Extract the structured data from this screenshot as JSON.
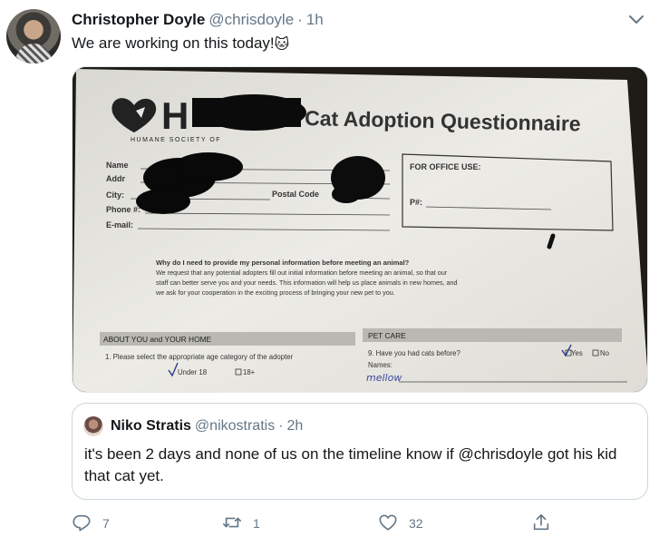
{
  "tweet": {
    "author": {
      "display_name": "Christopher Doyle",
      "handle": "@chrisdoyle",
      "time": "1h"
    },
    "separator": "·",
    "text": "We are working on this today!",
    "emoji": "🐱",
    "media": {
      "org_letters": "H",
      "org_name": "HUMANE SOCIETY OF",
      "title": "Cat Adoption Questionnaire",
      "fields": {
        "name": "Name",
        "address": "Addr",
        "city": "City:",
        "postal": "Postal Code",
        "phone": "Phone #:",
        "email": "E-mail:"
      },
      "office_use": "FOR OFFICE USE:",
      "p_number": "P#:",
      "why_heading": "Why do I need to provide my personal information before meeting an animal?",
      "why_lines": [
        "We request that any potential adopters fill out initial information before meeting an animal, so that our",
        "staff can better serve you and your needs. This information will help us place animals in new homes, and",
        "we ask for your cooperation in the exciting process of bringing your new pet to you."
      ],
      "section_left": "ABOUT YOU and YOUR HOME",
      "section_right": "PET CARE",
      "q1": "1.  Please select the appropriate age category of the adopter",
      "q1_opt1": "Under 18",
      "q1_opt2": "18+",
      "q9": "9.  Have you had cats before?",
      "q9_yes": "Yes",
      "q9_no": "No",
      "names_label": "Names:",
      "names_value": "mellow"
    },
    "quote": {
      "display_name": "Niko Stratis",
      "handle": "@nikostratis",
      "time": "2h",
      "text": "it's been 2 days and none of us on the timeline know if @chrisdoyle got his kid that cat yet."
    },
    "actions": {
      "reply_count": "7",
      "retweet_count": "1",
      "like_count": "32"
    },
    "icons": {
      "reply": "reply-icon",
      "retweet": "retweet-icon",
      "like": "heart-icon",
      "share": "share-icon",
      "more": "chevron-down-icon"
    },
    "colors": {
      "secondary_text": "#657786",
      "border": "#ccd6dd"
    }
  }
}
